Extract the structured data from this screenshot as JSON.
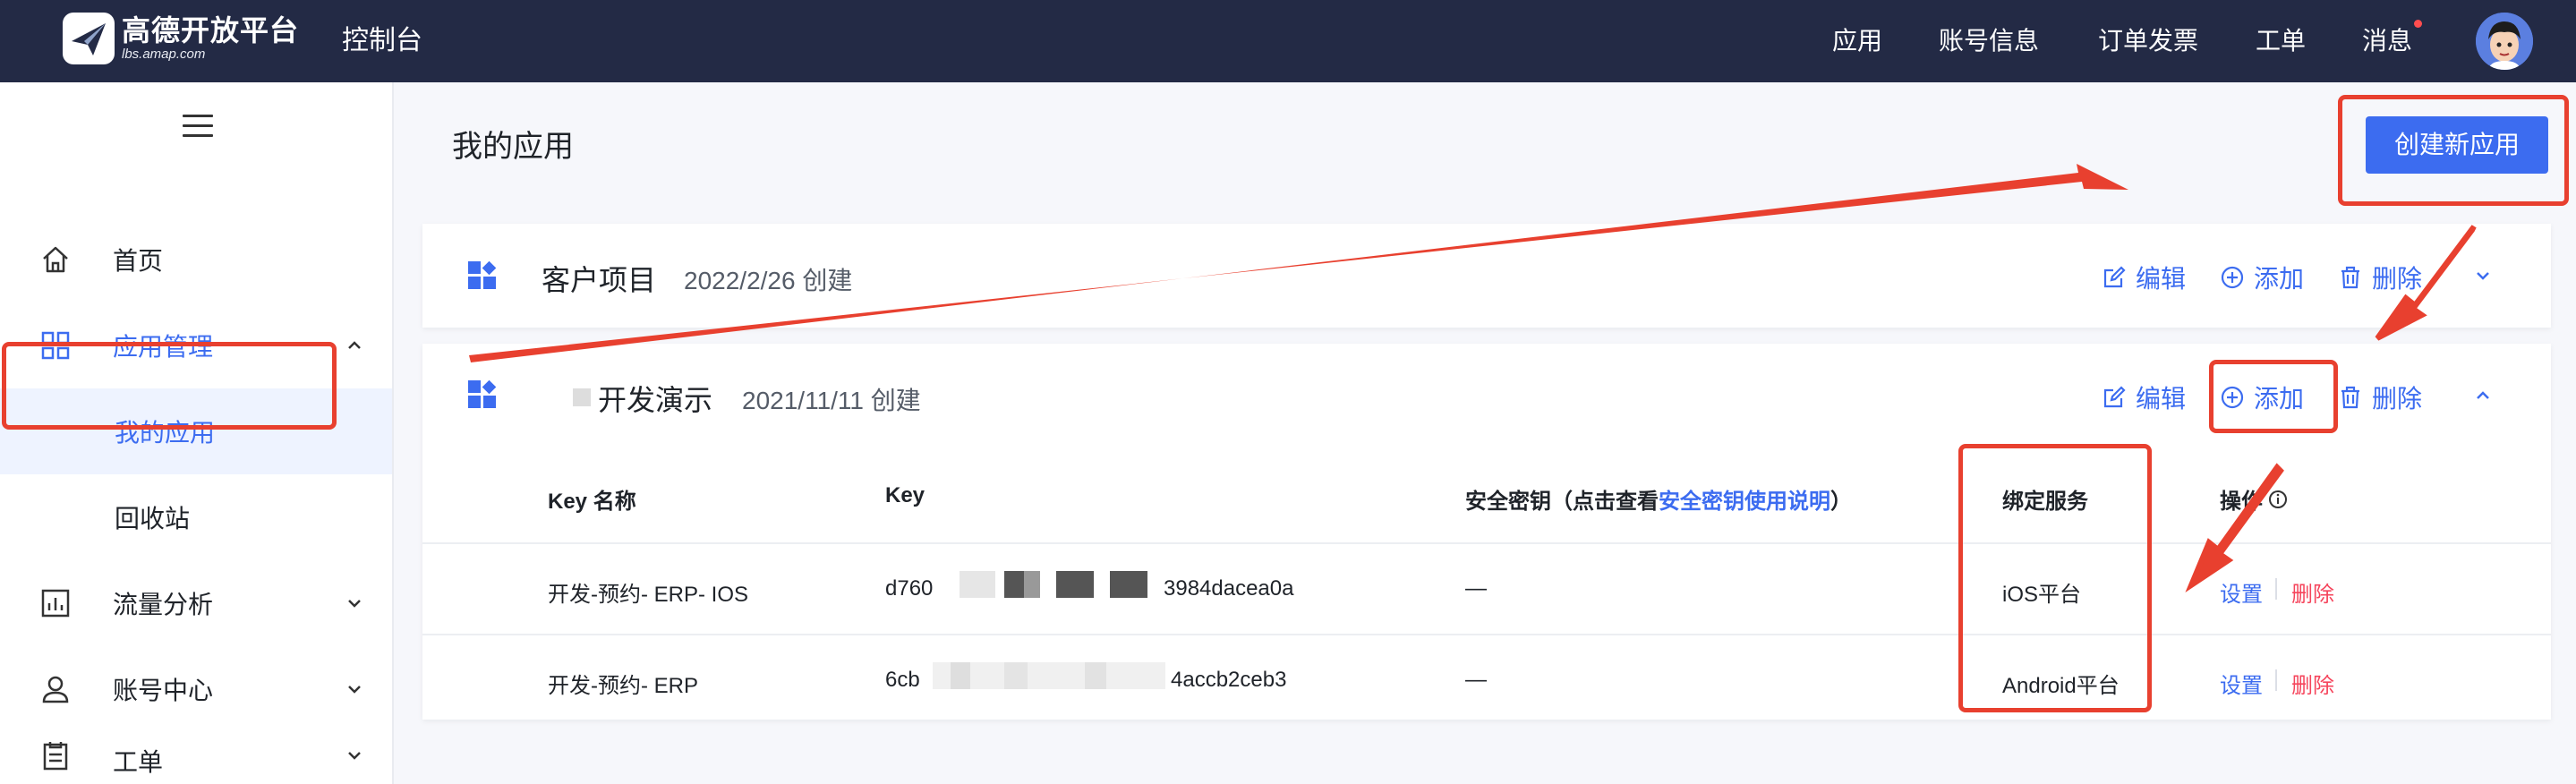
{
  "brand": {
    "title": "高德开放平台",
    "subtitle": "lbs.amap.com"
  },
  "header": {
    "console": "控制台",
    "nav": [
      "应用",
      "账号信息",
      "订单发票",
      "工单",
      "消息"
    ],
    "has_unread_message": true
  },
  "sidebar": {
    "items": [
      {
        "label": "首页",
        "icon": "home-icon"
      },
      {
        "label": "应用管理",
        "icon": "grid-icon",
        "expanded": true
      },
      {
        "label": "我的应用",
        "selected": true
      },
      {
        "label": "回收站"
      },
      {
        "label": "流量分析",
        "icon": "chart-icon"
      },
      {
        "label": "账号中心",
        "icon": "user-icon"
      },
      {
        "label": "工单",
        "icon": "clipboard-icon"
      }
    ]
  },
  "main": {
    "title": "我的应用",
    "create_button": "创建新应用",
    "apps": [
      {
        "name": "客户项目",
        "date": "2022/2/26 创建",
        "edit": "编辑",
        "add": "添加",
        "delete": "删除"
      },
      {
        "name": "开发演示",
        "date": "2021/11/11 创建",
        "edit": "编辑",
        "add": "添加",
        "delete": "删除"
      }
    ],
    "table": {
      "headers": {
        "key_name": "Key 名称",
        "key": "Key",
        "secret_prefix": "安全密钥（点击查看",
        "secret_link": "安全密钥使用说明",
        "secret_suffix": "）",
        "service": "绑定服务",
        "ops": "操作"
      },
      "rows": [
        {
          "name": "开发-预约- ERP- IOS",
          "key_start": "d760",
          "key_end": "3984dacea0a",
          "secret": "—",
          "service": "iOS平台",
          "set": "设置",
          "delete": "删除"
        },
        {
          "name": "开发-预约- ERP",
          "key_start": "6cb",
          "key_end": "4accb2ceb3",
          "secret": "—",
          "service": "Android平台",
          "set": "设置",
          "delete": "删除"
        }
      ]
    }
  },
  "colors": {
    "accent": "#3c6cf0",
    "topbar": "#232a45",
    "annotation": "#e8402f",
    "danger": "#f5455c"
  }
}
